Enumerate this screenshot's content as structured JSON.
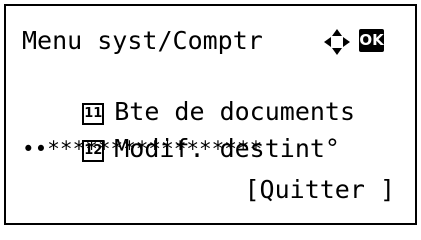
{
  "screen": {
    "title": "Menu syst/Comptr",
    "ok_label": "OK",
    "arrows_icon": "four-way-arrows-icon",
    "items": [
      {
        "number": "11",
        "label": "Bte de documents"
      },
      {
        "number": "12",
        "label": "Modif. destint°"
      }
    ],
    "separator": "••*****************",
    "quit_label": "[Quitter ]"
  },
  "colors": {
    "foreground": "#000000",
    "background": "#ffffff"
  }
}
